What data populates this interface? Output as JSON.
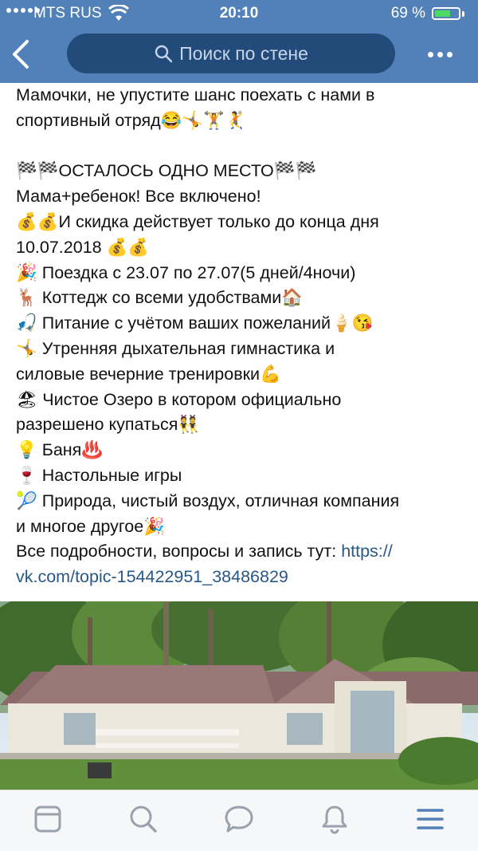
{
  "status_bar": {
    "carrier": "MTS RUS",
    "time": "20:10",
    "battery_percent": "69 %",
    "battery_level": 0.69
  },
  "header": {
    "search_placeholder": "Поиск по стене"
  },
  "post": {
    "lines": [
      "Мамочки, не упустите шанс поехать с нами в",
      "спортивный отряд😂🤸🏋️🤾",
      "",
      "🏁🏁ОСТАЛОСЬ ОДНО МЕСТО🏁🏁",
      "Мама+ребенок! Все включено!",
      "💰💰И скидка действует только до конца дня",
      "10.07.2018 💰💰",
      "🎉 Поездка с 23.07 по 27.07(5 дней/4ночи)",
      "🦌 Коттедж со всеми удобствами🏠",
      "🎣 Питание с учётом ваших пожеланий🍦😘",
      "🤸 Утренняя дыхательная гимнастика и",
      "силовые вечерние тренировки💪",
      "🏖 Чистое Озеро в котором официально",
      "разрешено купаться👯",
      "💡 Баня♨️",
      "🍷 Настольные игры",
      "🎾 Природа, чистый воздух, отличная компания",
      "и многое другое🎉"
    ],
    "link_prefix": "Все подробности, вопросы и запись тут: ",
    "link_part1": "https://",
    "link_part2": "vk.com/topic-154422951_38486829"
  },
  "tabbar": {
    "icons": [
      "news-icon",
      "search-icon",
      "messages-icon",
      "notifications-icon",
      "menu-icon"
    ]
  },
  "colors": {
    "brand": "#5181b8",
    "search_bg": "#224b7a",
    "link": "#2a5885",
    "tab_icon": "#99a2ad",
    "menu_icon": "#5181b8"
  }
}
